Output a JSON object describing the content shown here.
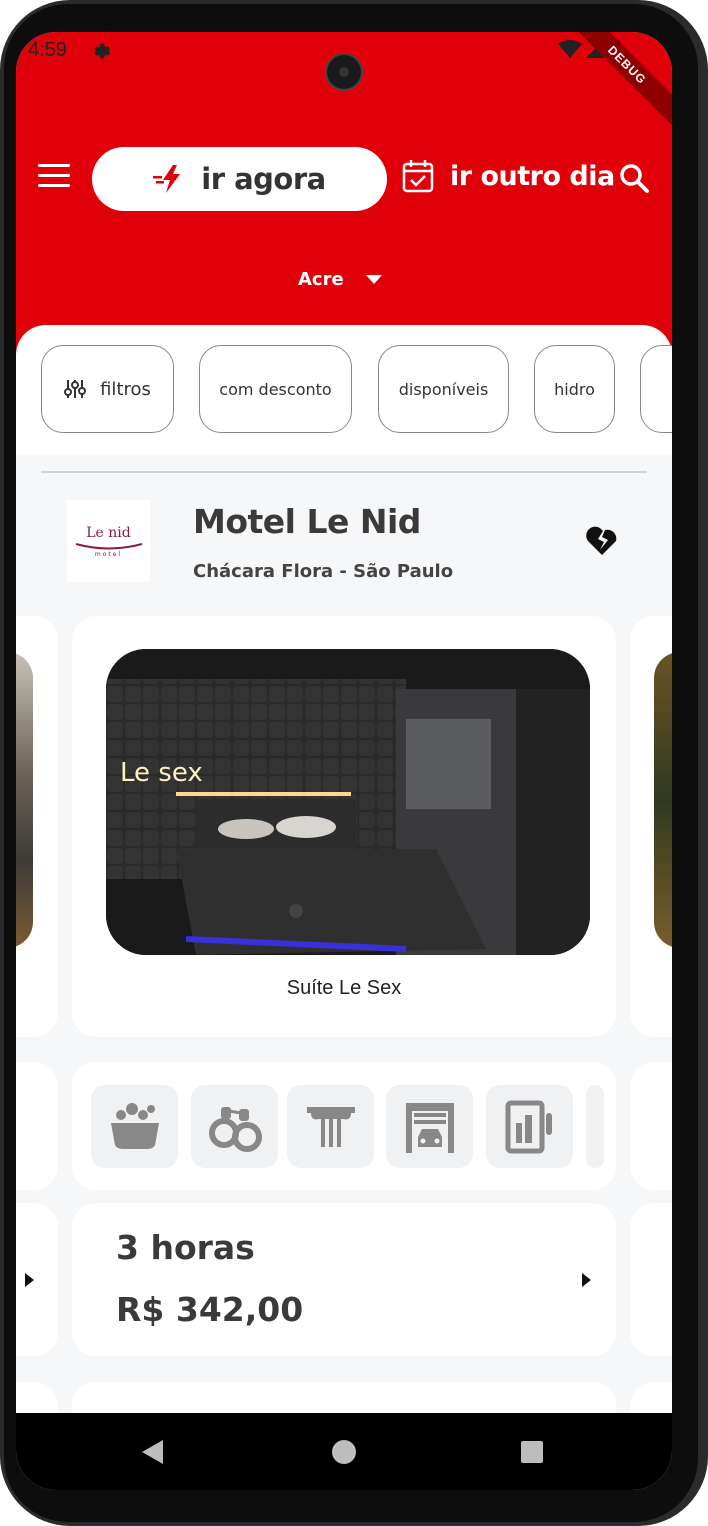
{
  "status_bar": {
    "time": "4:59",
    "debug_label": "DEBUG"
  },
  "header": {
    "go_now_label": "ir agora",
    "other_day_label": "ir outro dia",
    "state": "Acre",
    "accent_color": "#e0000a"
  },
  "filters": {
    "chips": [
      {
        "label": "filtros",
        "icon": "sliders-icon"
      },
      {
        "label": "com desconto"
      },
      {
        "label": "disponíveis"
      },
      {
        "label": "hidro"
      }
    ]
  },
  "motel": {
    "name": "Motel Le Nid",
    "location": "Chácara Flora - São Paulo",
    "logo_text": "Le nid",
    "logo_sub": "motel",
    "favorite_icon": "broken-heart-icon"
  },
  "suite": {
    "name": "Suíte Le Sex",
    "photo_sign": "Le sex"
  },
  "amenities": [
    {
      "icon": "bathtub-icon"
    },
    {
      "icon": "handcuffs-icon"
    },
    {
      "icon": "pillar-icon"
    },
    {
      "icon": "garage-icon"
    },
    {
      "icon": "minibar-icon"
    }
  ],
  "price": {
    "duration": "3 horas",
    "value": "R$ 342,00"
  }
}
